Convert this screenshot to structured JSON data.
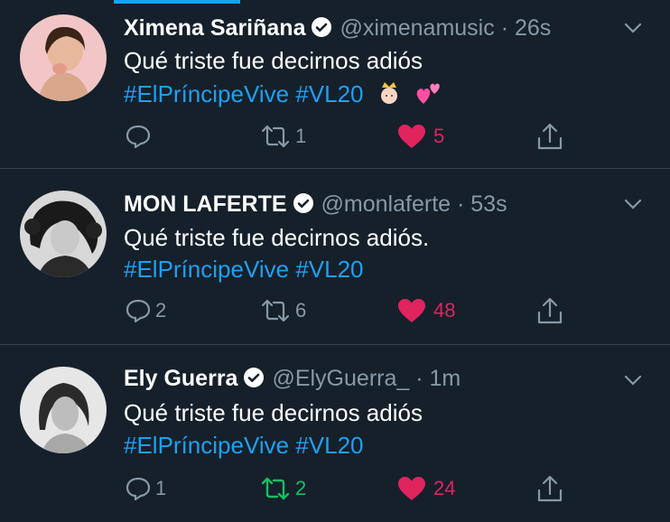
{
  "tweets": [
    {
      "name": "Ximena Sariñana",
      "handle": "@ximenamusic",
      "time": "· 26s",
      "text": "Qué triste fue decirnos adiós",
      "hashtags": [
        "#ElPríncipeVive",
        "#VL20"
      ],
      "emojis": [
        "prince-emoji",
        "two-hearts-emoji"
      ],
      "replies": "",
      "retweets": "1",
      "likes": "5",
      "liked": true,
      "retweeted": false
    },
    {
      "name": "MON LAFERTE",
      "handle": "@monlaferte",
      "time": "· 53s",
      "text": "Qué triste fue decirnos adiós.",
      "hashtags": [
        "#ElPríncipeVive",
        "#VL20"
      ],
      "replies": "2",
      "retweets": "6",
      "likes": "48",
      "liked": true,
      "retweeted": false
    },
    {
      "name": "Ely Guerra",
      "handle": "@ElyGuerra_",
      "time": "· 1m",
      "text": "Qué triste fue decirnos adiós",
      "hashtags": [
        "#ElPríncipeVive",
        "#VL20"
      ],
      "replies": "1",
      "retweets": "2",
      "likes": "24",
      "liked": true,
      "retweeted": true
    }
  ],
  "colors": {
    "background": "#15202b",
    "accent": "#1da1f2",
    "like": "#e0245e",
    "retweet": "#17bf63",
    "muted": "#8899a6"
  }
}
